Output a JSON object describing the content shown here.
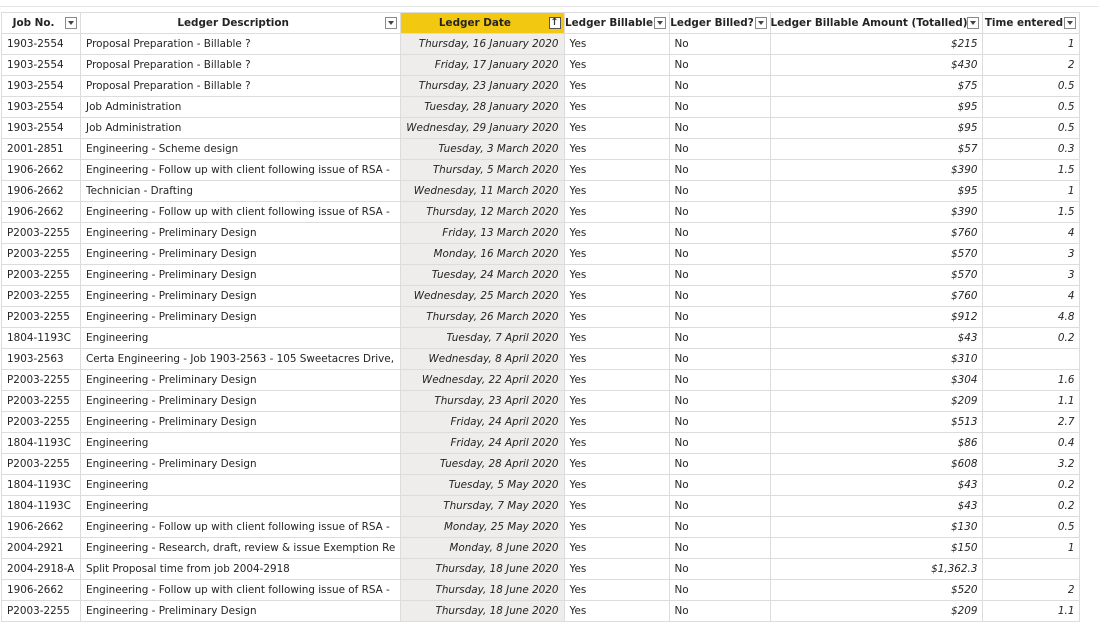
{
  "columns": [
    {
      "key": "job",
      "label": "Job No."
    },
    {
      "key": "desc",
      "label": "Ledger Description"
    },
    {
      "key": "date",
      "label": "Ledger Date"
    },
    {
      "key": "billable",
      "label": "Ledger Billable"
    },
    {
      "key": "billed",
      "label": "Ledger Billed?"
    },
    {
      "key": "amount",
      "label": "Ledger Billable Amount (Totalled)"
    },
    {
      "key": "time",
      "label": "Time entered"
    }
  ],
  "rows": [
    {
      "job": "1903-2554",
      "desc": "Proposal Preparation - Billable ?",
      "date": "Thursday, 16 January 2020",
      "billable": "Yes",
      "billed": "No",
      "amount": "$215",
      "time": "1"
    },
    {
      "job": "1903-2554",
      "desc": "Proposal Preparation - Billable ?",
      "date": "Friday, 17 January 2020",
      "billable": "Yes",
      "billed": "No",
      "amount": "$430",
      "time": "2"
    },
    {
      "job": "1903-2554",
      "desc": "Proposal Preparation - Billable ?",
      "date": "Thursday, 23 January 2020",
      "billable": "Yes",
      "billed": "No",
      "amount": "$75",
      "time": "0.5"
    },
    {
      "job": "1903-2554",
      "desc": "Job Administration",
      "date": "Tuesday, 28 January 2020",
      "billable": "Yes",
      "billed": "No",
      "amount": "$95",
      "time": "0.5"
    },
    {
      "job": "1903-2554",
      "desc": "Job Administration",
      "date": "Wednesday, 29 January 2020",
      "billable": "Yes",
      "billed": "No",
      "amount": "$95",
      "time": "0.5"
    },
    {
      "job": "2001-2851",
      "desc": "Engineering - Scheme design",
      "date": "Tuesday, 3 March 2020",
      "billable": "Yes",
      "billed": "No",
      "amount": "$57",
      "time": "0.3"
    },
    {
      "job": "1906-2662",
      "desc": "Engineering - Follow up with client following issue of RSA -",
      "date": "Thursday, 5 March 2020",
      "billable": "Yes",
      "billed": "No",
      "amount": "$390",
      "time": "1.5"
    },
    {
      "job": "1906-2662",
      "desc": "Technician - Drafting",
      "date": "Wednesday, 11 March 2020",
      "billable": "Yes",
      "billed": "No",
      "amount": "$95",
      "time": "1"
    },
    {
      "job": "1906-2662",
      "desc": "Engineering - Follow up with client following issue of RSA -",
      "date": "Thursday, 12 March 2020",
      "billable": "Yes",
      "billed": "No",
      "amount": "$390",
      "time": "1.5"
    },
    {
      "job": "P2003-2255",
      "desc": "Engineering - Preliminary Design",
      "date": "Friday, 13 March 2020",
      "billable": "Yes",
      "billed": "No",
      "amount": "$760",
      "time": "4"
    },
    {
      "job": "P2003-2255",
      "desc": "Engineering - Preliminary Design",
      "date": "Monday, 16 March 2020",
      "billable": "Yes",
      "billed": "No",
      "amount": "$570",
      "time": "3"
    },
    {
      "job": "P2003-2255",
      "desc": "Engineering - Preliminary Design",
      "date": "Tuesday, 24 March 2020",
      "billable": "Yes",
      "billed": "No",
      "amount": "$570",
      "time": "3"
    },
    {
      "job": "P2003-2255",
      "desc": "Engineering - Preliminary Design",
      "date": "Wednesday, 25 March 2020",
      "billable": "Yes",
      "billed": "No",
      "amount": "$760",
      "time": "4"
    },
    {
      "job": "P2003-2255",
      "desc": "Engineering - Preliminary Design",
      "date": "Thursday, 26 March 2020",
      "billable": "Yes",
      "billed": "No",
      "amount": "$912",
      "time": "4.8"
    },
    {
      "job": "1804-1193C",
      "desc": "Engineering",
      "date": "Tuesday, 7 April 2020",
      "billable": "Yes",
      "billed": "No",
      "amount": "$43",
      "time": "0.2"
    },
    {
      "job": "1903-2563",
      "desc": "Certa Engineering - Job 1903-2563 - 105 Sweetacres Drive,",
      "date": "Wednesday, 8 April 2020",
      "billable": "Yes",
      "billed": "No",
      "amount": "$310",
      "time": ""
    },
    {
      "job": "P2003-2255",
      "desc": "Engineering - Preliminary Design",
      "date": "Wednesday, 22 April 2020",
      "billable": "Yes",
      "billed": "No",
      "amount": "$304",
      "time": "1.6"
    },
    {
      "job": "P2003-2255",
      "desc": "Engineering - Preliminary Design",
      "date": "Thursday, 23 April 2020",
      "billable": "Yes",
      "billed": "No",
      "amount": "$209",
      "time": "1.1"
    },
    {
      "job": "P2003-2255",
      "desc": "Engineering - Preliminary Design",
      "date": "Friday, 24 April 2020",
      "billable": "Yes",
      "billed": "No",
      "amount": "$513",
      "time": "2.7"
    },
    {
      "job": "1804-1193C",
      "desc": "Engineering",
      "date": "Friday, 24 April 2020",
      "billable": "Yes",
      "billed": "No",
      "amount": "$86",
      "time": "0.4"
    },
    {
      "job": "P2003-2255",
      "desc": "Engineering - Preliminary Design",
      "date": "Tuesday, 28 April 2020",
      "billable": "Yes",
      "billed": "No",
      "amount": "$608",
      "time": "3.2"
    },
    {
      "job": "1804-1193C",
      "desc": "Engineering",
      "date": "Tuesday, 5 May 2020",
      "billable": "Yes",
      "billed": "No",
      "amount": "$43",
      "time": "0.2"
    },
    {
      "job": "1804-1193C",
      "desc": "Engineering",
      "date": "Thursday, 7 May 2020",
      "billable": "Yes",
      "billed": "No",
      "amount": "$43",
      "time": "0.2"
    },
    {
      "job": "1906-2662",
      "desc": "Engineering - Follow up with client following issue of RSA -",
      "date": "Monday, 25 May 2020",
      "billable": "Yes",
      "billed": "No",
      "amount": "$130",
      "time": "0.5"
    },
    {
      "job": "2004-2921",
      "desc": "Engineering - Research, draft, review & issue Exemption Re",
      "date": "Monday, 8 June 2020",
      "billable": "Yes",
      "billed": "No",
      "amount": "$150",
      "time": "1"
    },
    {
      "job": "2004-2918-A",
      "desc": "Split Proposal time from job 2004-2918",
      "date": "Thursday, 18 June 2020",
      "billable": "Yes",
      "billed": "No",
      "amount": "$1,362.3",
      "time": ""
    },
    {
      "job": "1906-2662",
      "desc": "Engineering - Follow up with client following issue of RSA -",
      "date": "Thursday, 18 June 2020",
      "billable": "Yes",
      "billed": "No",
      "amount": "$520",
      "time": "2"
    },
    {
      "job": "P2003-2255",
      "desc": "Engineering - Preliminary Design",
      "date": "Thursday, 18 June 2020",
      "billable": "Yes",
      "billed": "No",
      "amount": "$209",
      "time": "1.1"
    }
  ],
  "sort": {
    "column": "date",
    "direction": "ascending",
    "accent": "#f2c811"
  }
}
